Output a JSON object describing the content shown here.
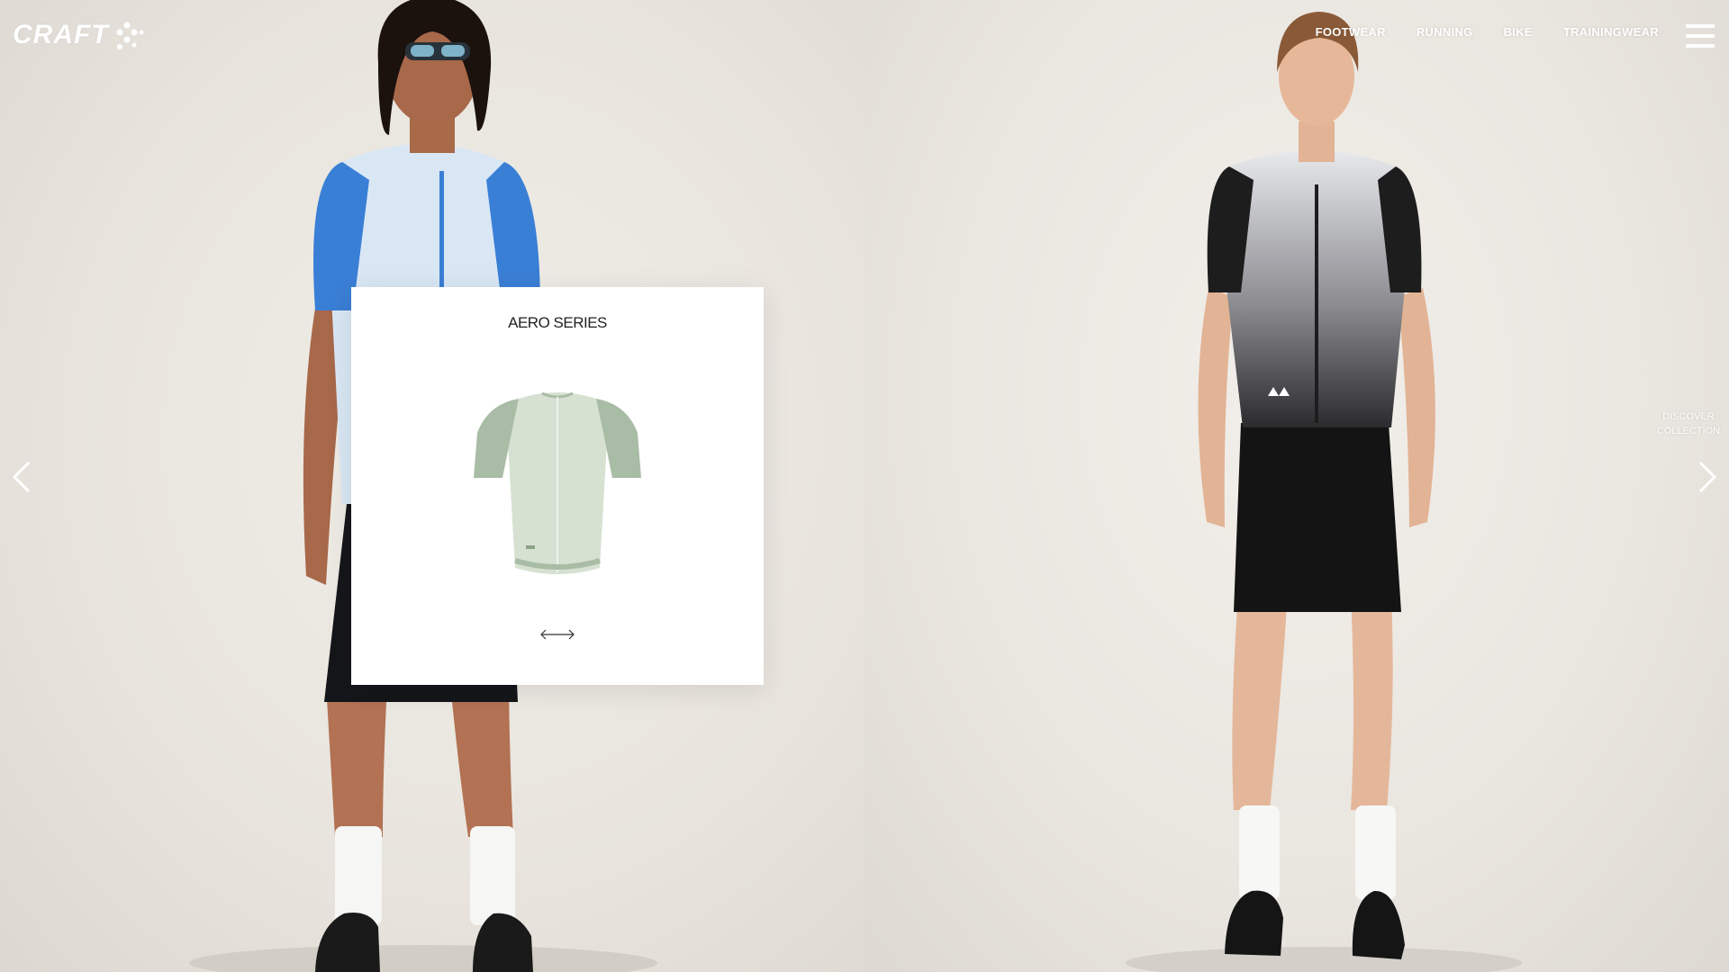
{
  "brand": {
    "logo_text": "CRAFT"
  },
  "nav": {
    "items": [
      "FOOTWEAR",
      "RUNNING",
      "BIKE",
      "TRAININGWEAR"
    ]
  },
  "menu": {
    "icon": "hamburger-icon"
  },
  "carousel": {
    "prev_icon": "chevron-left-icon",
    "next_icon": "chevron-right-icon",
    "discover_line1": "DISCOVER",
    "discover_line2": "COLLECTION"
  },
  "product_card": {
    "title": "AERO SERIES",
    "image_icon": "jersey-image",
    "swipe_icon": "double-arrow-icon"
  },
  "colors": {
    "background": "#eae7e1",
    "card": "#ffffff",
    "jersey_mint": "#c9d6c4",
    "model_jersey_blue": "#3a7fd6",
    "model_jersey_black": "#1d1d1d"
  }
}
